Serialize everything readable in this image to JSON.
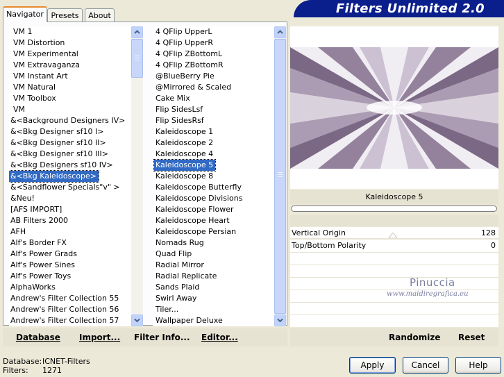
{
  "tabs": [
    {
      "label": "Navigator",
      "active": true
    },
    {
      "label": "Presets",
      "active": false
    },
    {
      "label": "About",
      "active": false
    }
  ],
  "banner_title": "Filters Unlimited 2.0",
  "categories": [
    "VM 1",
    "VM Distortion",
    "VM Experimental",
    "VM Extravaganza",
    "VM Instant Art",
    "VM Natural",
    "VM Toolbox",
    "VM",
    "&<Background Designers IV>",
    "&<Bkg Designer sf10 I>",
    "&<Bkg Designer sf10 II>",
    "&<Bkg Designer sf10 III>",
    "&<Bkg Designers sf10 IV>",
    "&<Bkg Kaleidoscope>",
    "&<Sandflower Specials\"v\" >",
    "&Neu!",
    "[AFS IMPORT]",
    "AB Filters 2000",
    "AFH",
    "Alf's Border FX",
    "Alf's Power Grads",
    "Alf's Power Sines",
    "Alf's Power Toys",
    "AlphaWorks",
    "Andrew's Filter Collection 55",
    "Andrew's Filter Collection 56",
    "Andrew's Filter Collection 57"
  ],
  "selected_category": "&<Bkg Kaleidoscope>",
  "filters": [
    "4 QFlip UpperL",
    "4 QFlip UpperR",
    "4 QFlip ZBottomL",
    "4 QFlip ZBottomR",
    "@BlueBerry Pie",
    "@Mirrored & Scaled",
    "Cake Mix",
    "Flip SidesLsf",
    "Flip SidesRsf",
    "Kaleidoscope 1",
    "Kaleidoscope 2",
    "Kaleidoscope 4",
    "Kaleidoscope 5",
    "Kaleidoscope 8",
    "Kaleidoscope Butterfly",
    "Kaleidoscope Divisions",
    "Kaleidoscope Flower",
    "Kaleidoscope Heart",
    "Kaleidoscope Persian",
    "Nomads Rug",
    "Quad Flip",
    "Radial Mirror",
    "Radial Replicate",
    "Sands Plaid",
    "Swirl Away",
    "Tiler...",
    "Wallpaper Deluxe"
  ],
  "selected_filter": "Kaleidoscope 5",
  "filter_name": "Kaleidoscope 5",
  "params": [
    {
      "label": "Vertical Origin",
      "value": "128"
    },
    {
      "label": "Top/Bottom Polarity",
      "value": "0"
    }
  ],
  "watermark": {
    "line1": "Pinuccia",
    "line2": "www.maidiregrafica.eu"
  },
  "toolbar": {
    "database": "Database",
    "import": "Import...",
    "filter_info": "Filter Info...",
    "editor": "Editor...",
    "randomize": "Randomize",
    "reset": "Reset"
  },
  "status": {
    "database_label": "Database:",
    "database_value": "ICNET-Filters",
    "filters_label": "Filters:",
    "filters_value": "1271"
  },
  "buttons": {
    "apply": "Apply",
    "cancel": "Cancel",
    "help": "Help"
  },
  "colors": {
    "banner": "#0a1e8c",
    "selection": "#316ac5",
    "tab_highlight": "#e68b2c"
  }
}
